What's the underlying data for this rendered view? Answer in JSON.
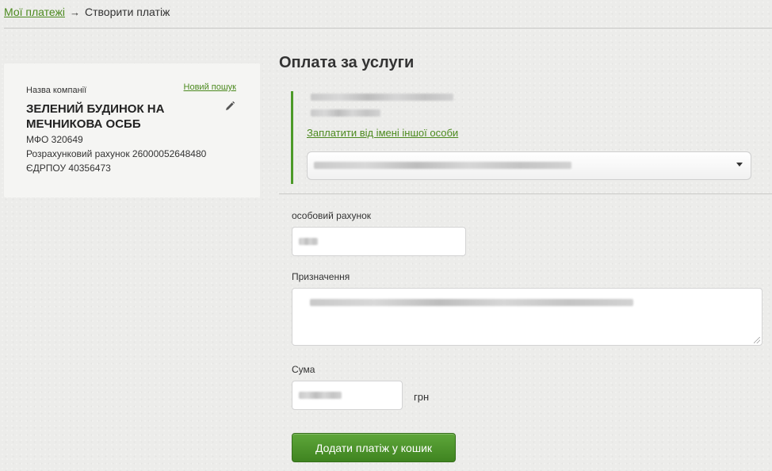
{
  "breadcrumb": {
    "parent_link": "Мої платежі",
    "separator": "→",
    "current": "Створити платіж"
  },
  "company": {
    "label": "Назва компанії",
    "new_search_link": "Новий пошук",
    "name": "ЗЕЛЕНИЙ БУДИНОК НА МЕЧНИКОВА ОСББ",
    "mfo": "МФО 320649",
    "account": "Розрахунковий рахунок 26000052648480",
    "edrpou": "ЄДРПОУ 40356473",
    "edit_icon": "pencil-icon"
  },
  "form": {
    "title": "Оплата за услуги",
    "other_person_link": "Заплатити від імені іншої особи",
    "payer_select_caret": "chevron-down-icon",
    "personal_account_label": "особовий рахунок",
    "purpose_label": "Призначення",
    "amount_label": "Сума",
    "currency": "грн",
    "submit_label": "Додати платіж у кошик"
  },
  "colors": {
    "accent_green": "#4c8a1f",
    "button_green": "#4f9a2c",
    "background": "#ececea"
  }
}
